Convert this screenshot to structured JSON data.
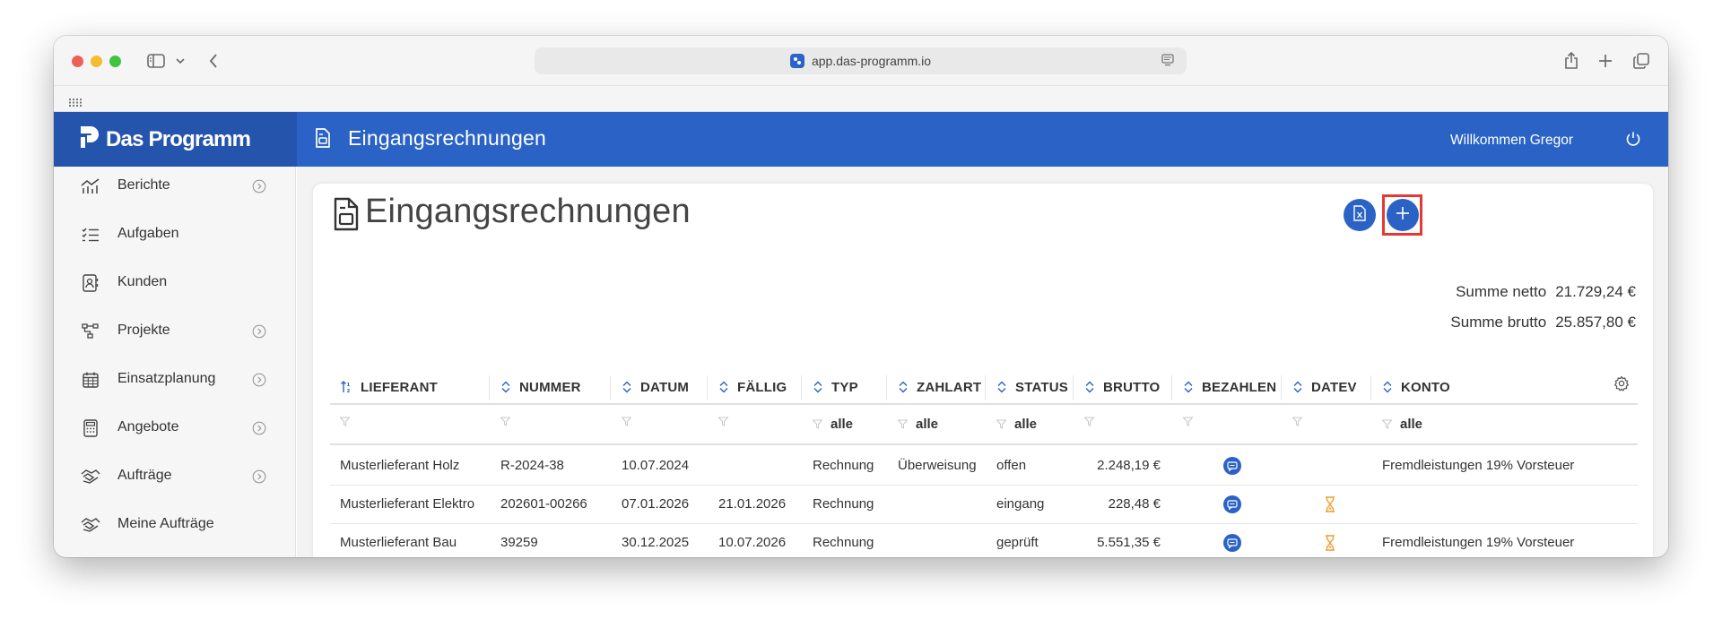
{
  "browser": {
    "url": "app.das-programm.io"
  },
  "app": {
    "brand": "Das Programm",
    "page_title": "Eingangsrechnungen",
    "welcome": "Willkommen Gregor",
    "accent": "#2a63c5",
    "brand_bg": "#2554ad"
  },
  "sidebar": {
    "items": [
      {
        "label": "Berichte",
        "icon": "chart-icon",
        "expandable": true
      },
      {
        "label": "Aufgaben",
        "icon": "checklist-icon",
        "expandable": false
      },
      {
        "label": "Kunden",
        "icon": "contacts-icon",
        "expandable": false
      },
      {
        "label": "Projekte",
        "icon": "hierarchy-icon",
        "expandable": true
      },
      {
        "label": "Einsatzplanung",
        "icon": "calendar-icon",
        "expandable": true
      },
      {
        "label": "Angebote",
        "icon": "calculator-icon",
        "expandable": true
      },
      {
        "label": "Aufträge",
        "icon": "handshake-icon",
        "expandable": true
      },
      {
        "label": "Meine Aufträge",
        "icon": "handshake-icon",
        "expandable": false
      }
    ]
  },
  "card": {
    "title": "Eingangsrechnungen",
    "summary": {
      "netto_label": "Summe netto",
      "netto_value": "21.729,24 €",
      "brutto_label": "Summe brutto",
      "brutto_value": "25.857,80 €"
    }
  },
  "table": {
    "columns": [
      "LIEFERANT",
      "NUMMER",
      "DATUM",
      "FÄLLIG",
      "TYP",
      "ZAHLART",
      "STATUS",
      "BRUTTO",
      "BEZAHLEN",
      "DATEV",
      "KONTO"
    ],
    "filters": [
      "",
      "",
      "",
      "",
      "alle",
      "alle",
      "alle",
      "",
      "",
      "",
      "alle"
    ],
    "rows": [
      {
        "lieferant": "Musterlieferant Holz",
        "nummer": "R-2024-38",
        "datum": "10.07.2024",
        "faellig": "",
        "typ": "Rechnung",
        "zahlart": "Überweisung",
        "status": "offen",
        "brutto": "2.248,19 €",
        "bezahlen": true,
        "datev": false,
        "konto": "Fremdleistungen 19% Vorsteuer"
      },
      {
        "lieferant": "Musterlieferant Elektro",
        "nummer": "202601-00266",
        "datum": "07.01.2026",
        "faellig": "21.01.2026",
        "typ": "Rechnung",
        "zahlart": "",
        "status": "eingang",
        "brutto": "228,48 €",
        "bezahlen": true,
        "datev": true,
        "konto": ""
      },
      {
        "lieferant": "Musterlieferant Bau",
        "nummer": "39259",
        "datum": "30.12.2025",
        "faellig": "10.07.2026",
        "typ": "Rechnung",
        "zahlart": "",
        "status": "geprüft",
        "brutto": "5.551,35 €",
        "bezahlen": true,
        "datev": true,
        "konto": "Fremdleistungen 19% Vorsteuer"
      }
    ]
  }
}
